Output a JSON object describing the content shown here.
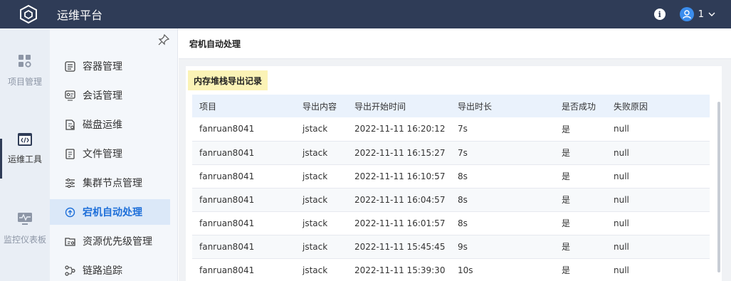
{
  "header": {
    "title": "运维平台",
    "user_count": "1"
  },
  "rail": {
    "items": [
      {
        "label": "项目管理",
        "icon": "grid-icon"
      },
      {
        "label": "运维工具",
        "icon": "code-icon",
        "active": true
      },
      {
        "label": "监控仪表板",
        "icon": "monitor-icon"
      }
    ]
  },
  "sidebar": {
    "items": [
      {
        "label": "容器管理",
        "icon": "container-icon"
      },
      {
        "label": "会话管理",
        "icon": "session-icon"
      },
      {
        "label": "磁盘运维",
        "icon": "disk-icon"
      },
      {
        "label": "文件管理",
        "icon": "file-icon"
      },
      {
        "label": "集群节点管理",
        "icon": "sliders-icon"
      },
      {
        "label": "宕机自动处理",
        "icon": "auto-recover-icon",
        "active": true
      },
      {
        "label": "资源优先级管理",
        "icon": "priority-icon"
      },
      {
        "label": "链路追踪",
        "icon": "trace-icon"
      }
    ]
  },
  "main": {
    "breadcrumb": "宕机自动处理",
    "section_title": "内存堆栈导出记录",
    "table": {
      "columns": [
        "项目",
        "导出内容",
        "导出开始时间",
        "导出时长",
        "是否成功",
        "失败原因"
      ],
      "rows": [
        [
          "fanruan8041",
          "jstack",
          "2022-11-11 16:20:12",
          "7s",
          "是",
          "null"
        ],
        [
          "fanruan8041",
          "jstack",
          "2022-11-11 16:15:27",
          "7s",
          "是",
          "null"
        ],
        [
          "fanruan8041",
          "jstack",
          "2022-11-11 16:10:57",
          "8s",
          "是",
          "null"
        ],
        [
          "fanruan8041",
          "jstack",
          "2022-11-11 16:04:57",
          "8s",
          "是",
          "null"
        ],
        [
          "fanruan8041",
          "jstack",
          "2022-11-11 16:01:57",
          "8s",
          "是",
          "null"
        ],
        [
          "fanruan8041",
          "jstack",
          "2022-11-11 15:45:45",
          "9s",
          "是",
          "null"
        ],
        [
          "fanruan8041",
          "jstack",
          "2022-11-11 15:39:30",
          "10s",
          "是",
          "null"
        ]
      ]
    }
  },
  "colors": {
    "header_bg": "#2f3c57",
    "accent": "#1e6fd9",
    "tag_bg": "#fbf3b6"
  }
}
